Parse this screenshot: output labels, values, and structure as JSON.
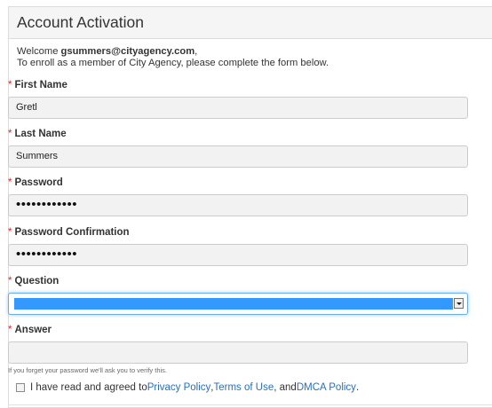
{
  "panel": {
    "title": "Account Activation"
  },
  "intro": {
    "welcome_prefix": "Welcome ",
    "email": "gsummers@cityagency.com",
    "welcome_suffix": ",",
    "instructions": "To enroll as a member of  City Agency, please complete the form below."
  },
  "required_marker": "*",
  "fields": {
    "first_name": {
      "label": "First Name",
      "value": "Gretl"
    },
    "last_name": {
      "label": "Last Name",
      "value": "Summers"
    },
    "password": {
      "label": "Password",
      "value": "••••••••••••"
    },
    "password_confirmation": {
      "label": "Password Confirmation",
      "value": "••••••••••••"
    },
    "question": {
      "label": "Question",
      "selected": ""
    },
    "answer": {
      "label": "Answer",
      "value": ""
    }
  },
  "hint": "If you forget your password we'll ask you to verify this.",
  "agreement": {
    "prefix": "I have read and agreed to ",
    "privacy": "Privacy Policy",
    "sep1": ", ",
    "terms": "Terms of Use",
    "sep2": ", and ",
    "dmca": "DMCA Policy",
    "suffix": ".",
    "checked": false
  },
  "colors": {
    "accent": "#3399ff",
    "link": "#2a6fb8",
    "required": "#c9302c"
  }
}
